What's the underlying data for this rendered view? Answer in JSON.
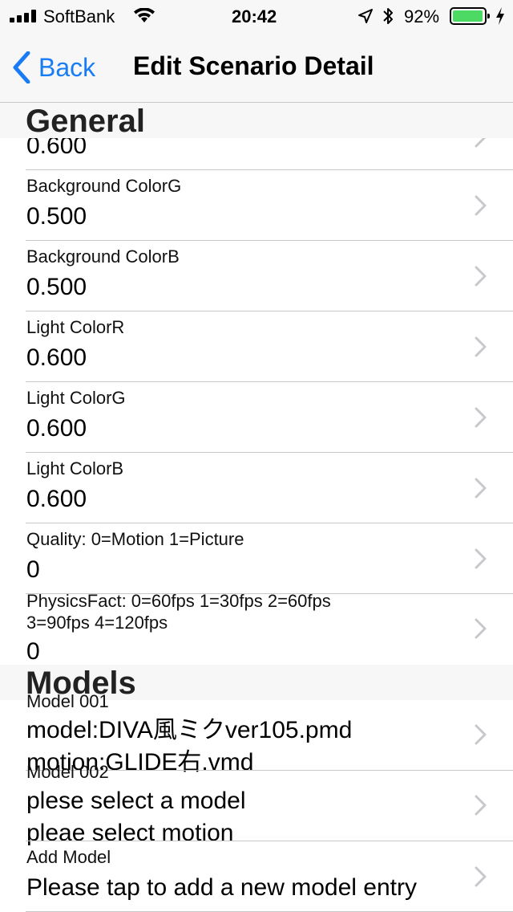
{
  "status": {
    "carrier": "SoftBank",
    "time": "20:42",
    "battery": "92%",
    "battery_level": 0.92,
    "battery_color": "#4cd964"
  },
  "nav": {
    "back_label": "Back",
    "title": "Edit Scenario Detail",
    "accent": "#1a7cf5"
  },
  "sections": {
    "general": "General",
    "models": "Models"
  },
  "general_rows": [
    {
      "label": "",
      "value": "0.600"
    },
    {
      "label": "Background ColorG",
      "value": "0.500"
    },
    {
      "label": "Background ColorB",
      "value": "0.500"
    },
    {
      "label": "Light ColorR",
      "value": "0.600"
    },
    {
      "label": "Light ColorG",
      "value": "0.600"
    },
    {
      "label": "Light ColorB",
      "value": "0.600"
    },
    {
      "label": "Quality: 0=Motion 1=Picture",
      "value": "0"
    },
    {
      "label_line1": "PhysicsFact: 0=60fps 1=30fps 2=60fps",
      "label_line2": "3=90fps 4=120fps",
      "value": "0"
    }
  ],
  "model_rows": [
    {
      "label": "Model 001",
      "line1": "model:DIVA風ミクver105.pmd",
      "line2": "motion:GLIDE右.vmd"
    },
    {
      "label": "Model 002",
      "line1": "plese select a model",
      "line2": "pleae select motion"
    },
    {
      "label": "Add Model",
      "line1": "Please tap to add a new model entry"
    }
  ]
}
